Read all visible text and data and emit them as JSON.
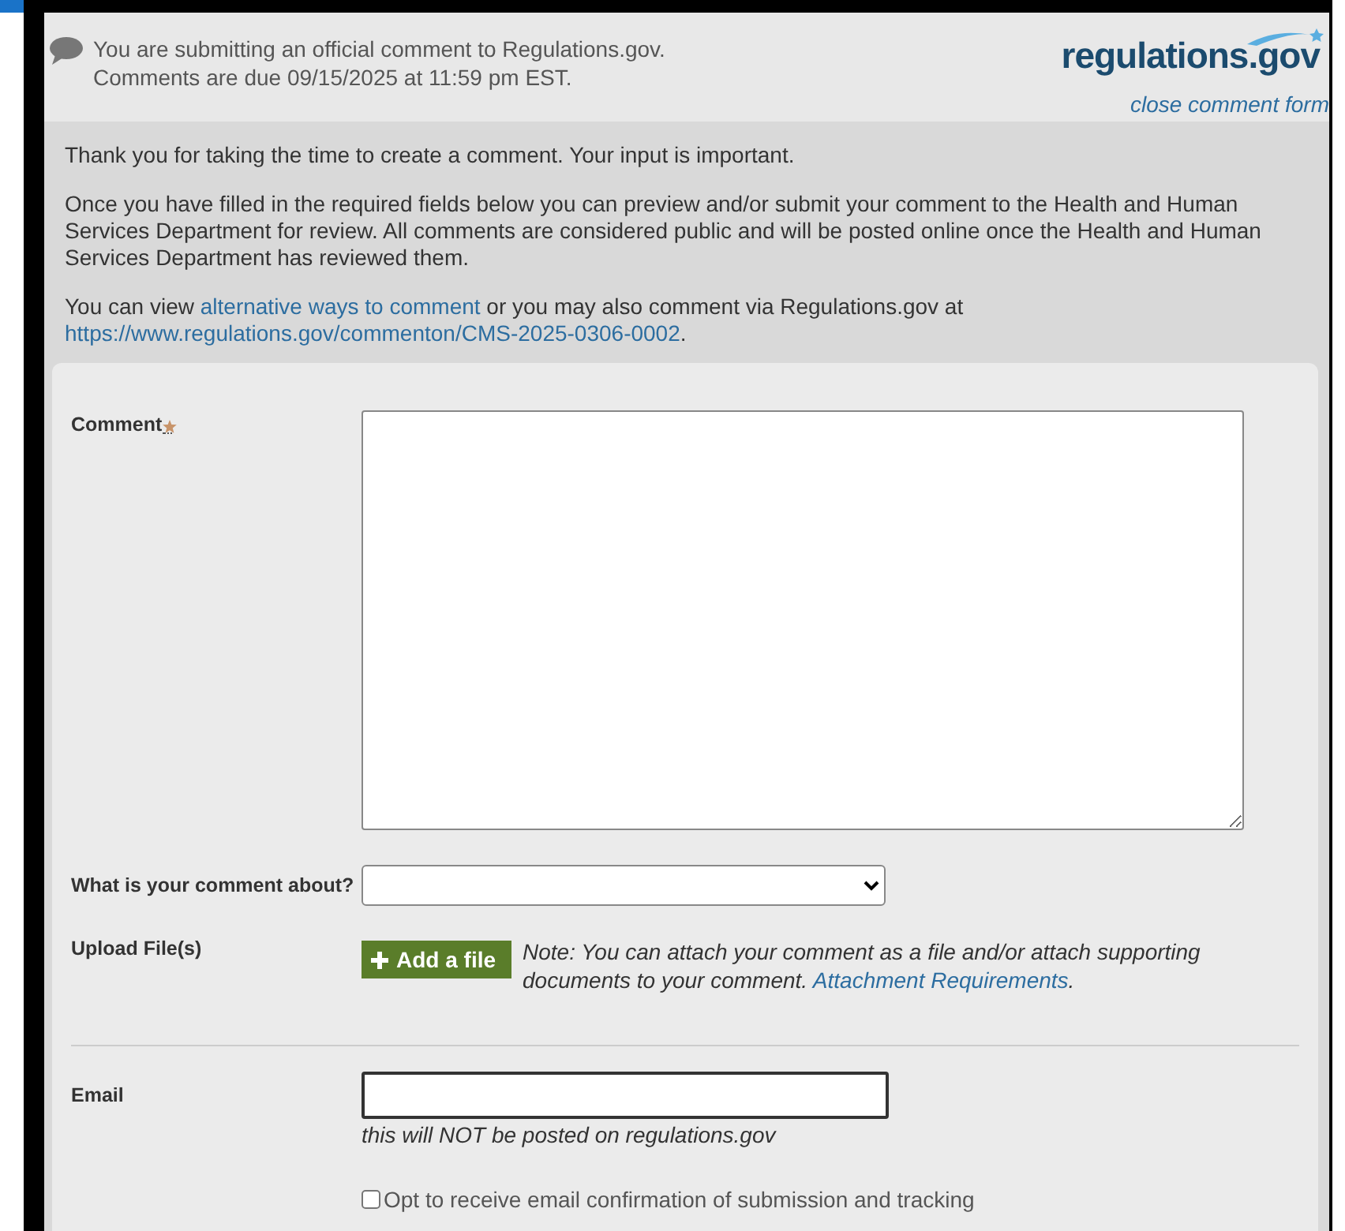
{
  "header": {
    "notice": [
      "You are submitting an official comment to Regulations.gov.",
      "Comments are due 09/15/2025 at 11:59 pm EST."
    ],
    "logo": "regulations.gov",
    "close_link": "close comment form"
  },
  "intro": [
    [
      {
        "kind": "text",
        "text": "Thank you for taking the time to create a comment. Your input is important."
      }
    ],
    [
      {
        "kind": "text",
        "text": "Once you have filled in the required fields below you can preview and/or submit your comment to the Health and Human Services Department for review. All comments are considered public and will be posted online once the Health and Human Services Department has reviewed them."
      }
    ],
    [
      {
        "kind": "text",
        "text": "You can view "
      },
      {
        "kind": "link",
        "text": "alternative ways to comment"
      },
      {
        "kind": "text",
        "text": " or you may also comment via Regulations.gov at "
      },
      {
        "kind": "link",
        "text": "https://www.regulations.gov/commenton/CMS-2025-0306-0002"
      },
      {
        "kind": "text",
        "text": "."
      }
    ]
  ],
  "form": {
    "comment": {
      "label": "Comment",
      "required": true
    },
    "about": {
      "label": "What is your comment about?"
    },
    "upload": {
      "label": "Upload File(s)",
      "button": "Add a file",
      "note": "Note: You can attach your comment as a file and/or attach supporting documents to your comment.",
      "note_link": "Attachment Requirements",
      "note_end": "."
    },
    "email": {
      "label": "Email",
      "hint": "this will NOT be posted on regulations.gov",
      "opt_in": {
        "label": "Opt to receive email confirmation of submission and tracking",
        "checked": false
      }
    }
  }
}
